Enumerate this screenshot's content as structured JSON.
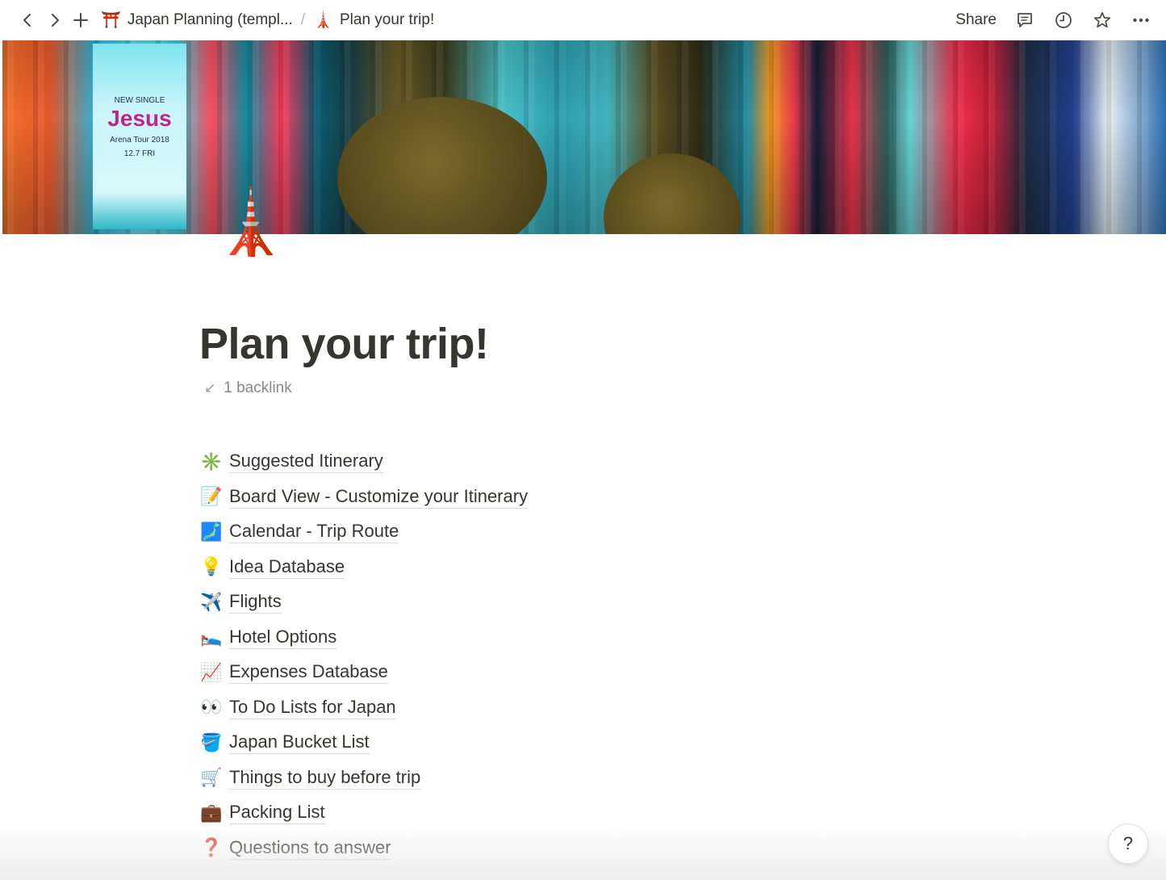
{
  "topbar": {
    "back_icon": "chevron-left-icon",
    "forward_icon": "chevron-right-icon",
    "new_page_icon": "plus-icon",
    "breadcrumbs": [
      {
        "emoji": "⛩️",
        "label": "Japan Planning (templ..."
      },
      {
        "emoji": "🗼",
        "label": "Plan your trip!"
      }
    ],
    "separator": "/",
    "share_label": "Share",
    "actions": [
      "comment-icon",
      "history-icon",
      "star-icon",
      "more-icon"
    ],
    "more_glyph": "•••"
  },
  "cover": {
    "sign_title": "Jesus",
    "sign_subtitle": "NEW SINGLE",
    "sign_line1": "Arena Tour 2018",
    "sign_line2": "12.7 FRI"
  },
  "page": {
    "icon": "🗼",
    "title": "Plan your trip!",
    "backlink_arrow": "↙",
    "backlink_label": "1 backlink"
  },
  "links": [
    {
      "emoji": "✳️",
      "label": "Suggested Itinerary"
    },
    {
      "emoji": "📝",
      "label": "Board View - Customize your Itinerary"
    },
    {
      "emoji": "🗾",
      "label": "Calendar - Trip Route"
    },
    {
      "emoji": "💡",
      "label": "Idea Database"
    },
    {
      "emoji": "✈️",
      "label": "Flights"
    },
    {
      "emoji": "🛌",
      "label": "Hotel Options"
    },
    {
      "emoji": "📈",
      "label": "Expenses Database"
    },
    {
      "emoji": "👀",
      "label": "To Do Lists for Japan"
    },
    {
      "emoji": "🪣",
      "label": "Japan Bucket List"
    },
    {
      "emoji": "🛒",
      "label": "Things to buy before trip"
    },
    {
      "emoji": "💼",
      "label": "Packing List"
    },
    {
      "emoji": "❓",
      "label": "Questions to answer"
    }
  ],
  "help": {
    "label": "?"
  }
}
